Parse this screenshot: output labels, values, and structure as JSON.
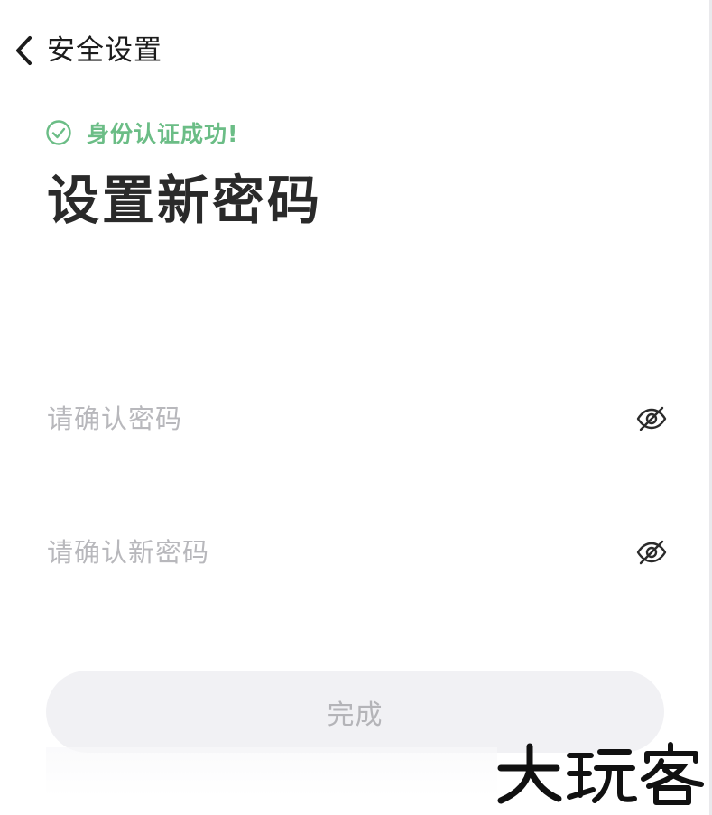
{
  "header": {
    "title": "安全设置",
    "back_icon": "chevron-left-icon"
  },
  "status": {
    "text": "身份认证成功!",
    "icon": "check-circle-icon",
    "color": "#6bbd86"
  },
  "page": {
    "title": "设置新密码"
  },
  "fields": {
    "confirm_password": {
      "placeholder": "请确认密码",
      "value": "",
      "toggle_icon": "eye-off-icon"
    },
    "new_password": {
      "placeholder": "请确认新密码",
      "value": "",
      "toggle_icon": "eye-off-icon"
    }
  },
  "actions": {
    "done_label": "完成",
    "done_enabled": false
  },
  "watermark": {
    "text": "大玩客"
  }
}
